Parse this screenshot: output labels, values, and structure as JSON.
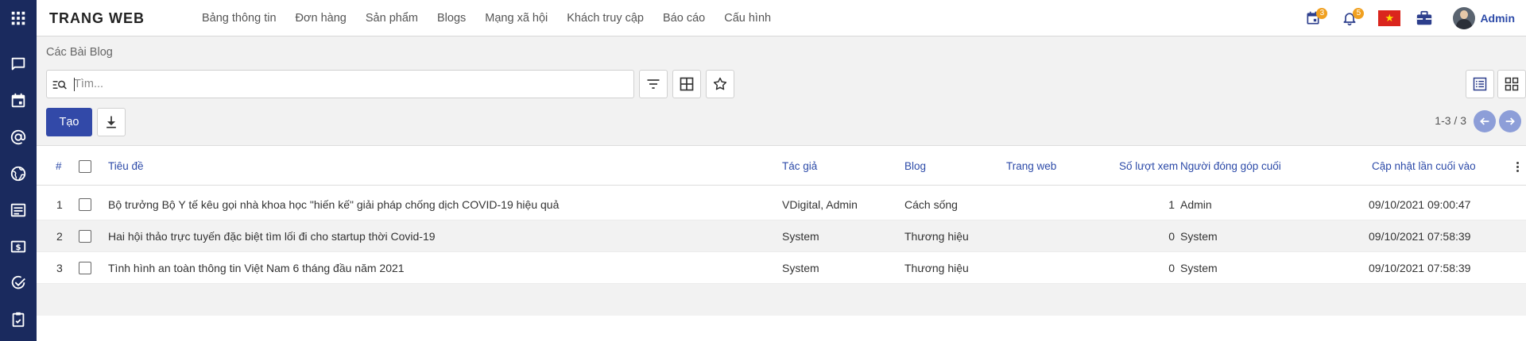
{
  "app": {
    "brand": "TRANG WEB",
    "menu": [
      "Bảng thông tin",
      "Đơn hàng",
      "Sản phẩm",
      "Blogs",
      "Mạng xã hội",
      "Khách truy cập",
      "Báo cáo",
      "Cấu hình"
    ],
    "user_name": "Admin",
    "activity_count": "3",
    "notification_count": "5",
    "flag_symbol": "★"
  },
  "sidebar": {
    "icons": [
      "apps-grid-icon",
      "chat-icon",
      "calendar-icon",
      "at-sign-icon",
      "globe-icon",
      "article-icon",
      "money-icon",
      "check-circle-icon",
      "clipboard-icon"
    ]
  },
  "control": {
    "breadcrumb": "Các Bài Blog",
    "search_placeholder": "Tìm...",
    "create_label": "Tạo",
    "pager": "1-3 / 3"
  },
  "table": {
    "columns": {
      "index": "#",
      "title": "Tiêu đề",
      "author": "Tác giả",
      "blog": "Blog",
      "website": "Trang web",
      "views": "Số lượt xem",
      "last_contributor": "Người đóng góp cuối",
      "updated": "Cập nhật lần cuối vào"
    },
    "rows": [
      {
        "index": "1",
        "title": "Bộ trưởng Bộ Y tế kêu gọi nhà khoa học \"hiến kế\" giải pháp chống dịch COVID-19 hiệu quả",
        "author": "VDigital, Admin",
        "blog": "Cách sống",
        "website": "",
        "views": "1",
        "last_contributor": "Admin",
        "updated": "09/10/2021 09:00:47"
      },
      {
        "index": "2",
        "title": "Hai hội thảo trực tuyến đặc biệt tìm lối đi cho startup thời Covid-19",
        "author": "System",
        "blog": "Thương hiệu",
        "website": "",
        "views": "0",
        "last_contributor": "System",
        "updated": "09/10/2021 07:58:39"
      },
      {
        "index": "3",
        "title": "Tình hình an toàn thông tin Việt Nam 6 tháng đầu năm 2021",
        "author": "System",
        "blog": "Thương hiệu",
        "website": "",
        "views": "0",
        "last_contributor": "System",
        "updated": "09/10/2021 07:58:39"
      }
    ]
  },
  "colors": {
    "rail": "#1a2a5e",
    "primary": "#3249a8",
    "header_text": "#2c4aa8",
    "badge": "#f0a020",
    "pager": "#8d9ed8"
  }
}
